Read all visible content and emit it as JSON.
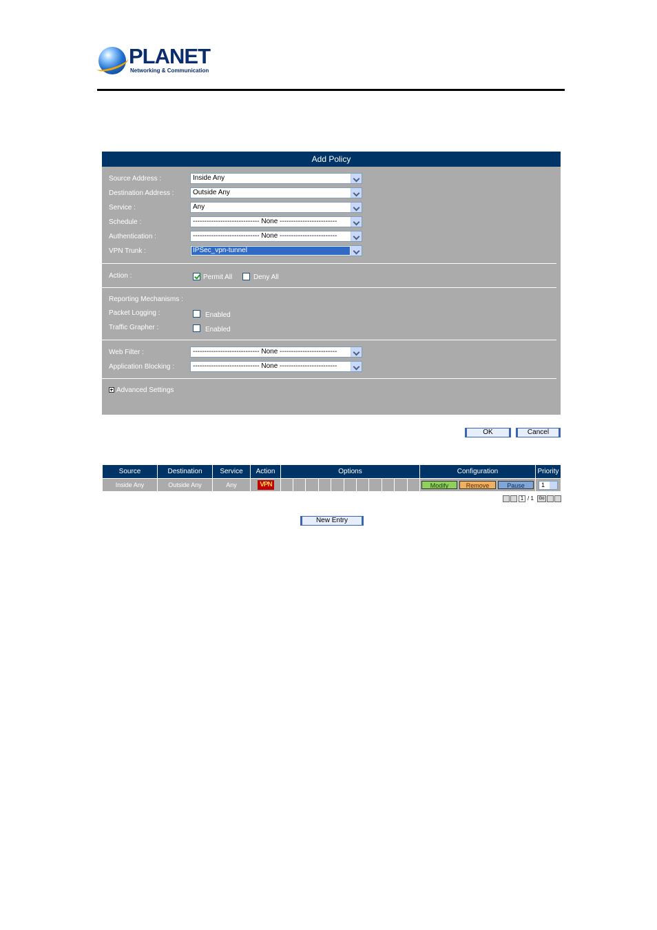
{
  "brand": {
    "name": "PLANET",
    "tagline": "Networking & Communication"
  },
  "panel": {
    "title": "Add Policy",
    "fields": [
      {
        "label": "Source Address :",
        "value": "Inside Any"
      },
      {
        "label": "Destination Address :",
        "value": "Outside Any"
      },
      {
        "label": "Service :",
        "value": "Any"
      },
      {
        "label": "Schedule :",
        "value": "----------------------------- None -------------------------"
      },
      {
        "label": "Authentication :",
        "value": "----------------------------- None -------------------------"
      },
      {
        "label": "VPN Trunk :",
        "value": "IPSec_vpn-tunnel"
      }
    ],
    "action_label": "Action :",
    "permit_label": "Permit All",
    "deny_label": "Deny All",
    "reporting_label": "Reporting Mechanisms :",
    "packet_logging_label": "Packet Logging :",
    "traffic_grapher_label": "Traffic Grapher :",
    "enabled_label": "Enabled",
    "web_filter_label": "Web Filter :",
    "web_filter_value": "----------------------------- None -------------------------",
    "app_blocking_label": "Application Blocking :",
    "app_blocking_value": "----------------------------- None -------------------------",
    "advanced_label": "Advanced Settings"
  },
  "buttons": {
    "ok": "OK",
    "cancel": "Cancel",
    "new_entry": "New Entry"
  },
  "table": {
    "headers": [
      "Source",
      "Destination",
      "Service",
      "Action",
      "Options",
      "Configuration",
      "Priority"
    ],
    "row": {
      "source": "Inside Any",
      "destination": "Outside Any",
      "service": "Any",
      "action_badge": "VPN",
      "modify": "Modify",
      "remove": "Remove",
      "pause": "Pause",
      "priority": "1"
    },
    "pager": {
      "current": "1",
      "sep": "/ 1",
      "go": "Go"
    }
  },
  "colors": {
    "header": "#003366",
    "panel": "#ababab",
    "modify": "#8ed05a",
    "remove": "#f0b060",
    "pause": "#7ea6d8"
  }
}
